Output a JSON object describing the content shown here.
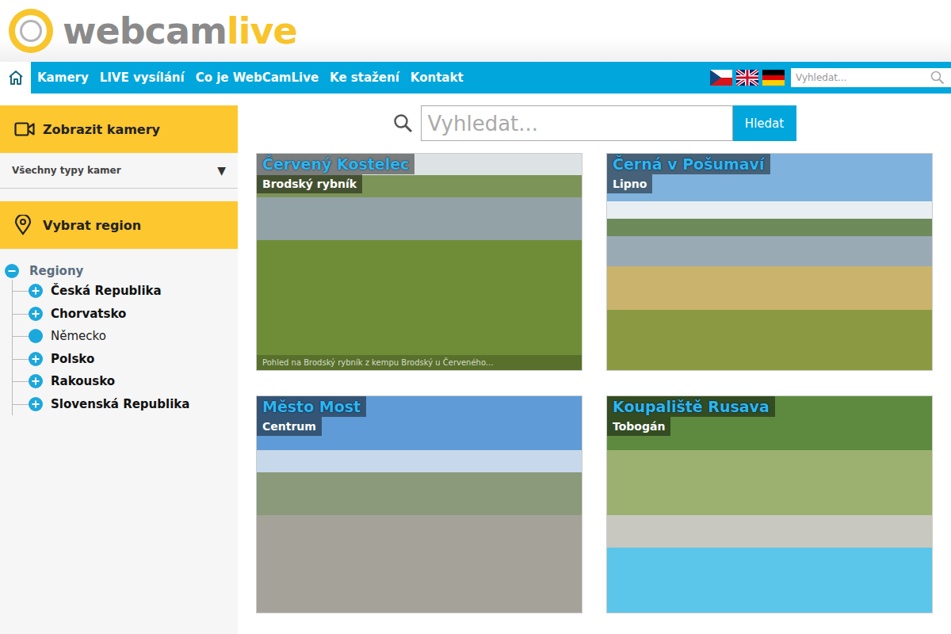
{
  "logo": {
    "part1": "webcam",
    "part2": "live"
  },
  "nav": {
    "home_selected": true,
    "items": [
      {
        "label": "Kamery",
        "selected": false
      },
      {
        "label": "LIVE vysílání",
        "selected": false
      },
      {
        "label": "Co je WebCamLive",
        "selected": false
      },
      {
        "label": "Ke stažení",
        "selected": false
      },
      {
        "label": "Kontakt",
        "selected": false
      }
    ]
  },
  "header_search": {
    "placeholder": "Vyhledat..."
  },
  "sidebar": {
    "cameras_heading": "Zobrazit kamery",
    "camera_type": {
      "value": "Všechny typy kamer",
      "arrow": "▼"
    },
    "region_heading": "Vybrat region",
    "tree": {
      "label": "Regiony",
      "expanded": true,
      "children": [
        {
          "label": "Česká Republika",
          "expandable": true
        },
        {
          "label": "Chorvatsko",
          "expandable": true
        },
        {
          "label": "Německo",
          "expandable": false
        },
        {
          "label": "Polsko",
          "expandable": true
        },
        {
          "label": "Rakousko",
          "expandable": true
        },
        {
          "label": "Slovenská Republika",
          "expandable": true
        }
      ]
    }
  },
  "search": {
    "placeholder": "Vyhledat...",
    "button": "Hledat"
  },
  "cameras": [
    {
      "title": "Červený Kostelec",
      "subtitle": "Brodský rybník",
      "caption": "Pohled na Brodský rybník z kempu Brodský u Červeného..."
    },
    {
      "title": "Černá v Pošumaví",
      "subtitle": "Lipno",
      "caption": ""
    },
    {
      "title": "Město Most",
      "subtitle": "Centrum",
      "caption": ""
    },
    {
      "title": "Koupaliště Rusava",
      "subtitle": "Tobogán",
      "caption": ""
    }
  ]
}
